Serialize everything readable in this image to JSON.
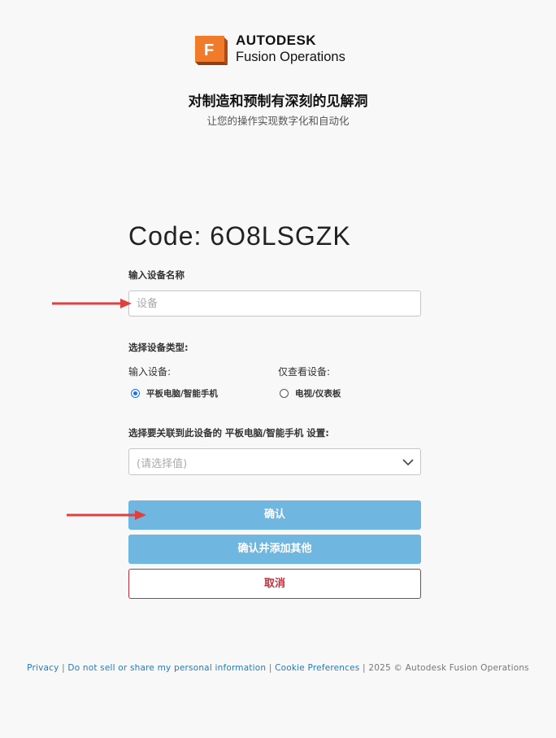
{
  "brand": {
    "name": "AUTODESK",
    "product": "Fusion Operations",
    "mark_letter": "F",
    "mark_color": "#f07b2a"
  },
  "headline": "对制造和预制有深刻的见解洞",
  "subheadline": "让您的操作实现数字化和自动化",
  "code_label": "Code: 6O8LSGZK",
  "device_name": {
    "label": "输入设备名称",
    "placeholder": "设备",
    "value": ""
  },
  "device_type": {
    "label": "选择设备类型:",
    "input_column_label": "输入设备:",
    "view_column_label": "仅查看设备:",
    "options": [
      {
        "label": "平板电脑/智能手机",
        "checked": true
      },
      {
        "label": "电视/仪表板",
        "checked": false
      }
    ]
  },
  "link_select": {
    "label": "选择要关联到此设备的 平板电脑/智能手机 设置:",
    "placeholder": "(请选择值)",
    "icon": "chevron-down-icon"
  },
  "buttons": {
    "confirm": "确认",
    "confirm_add": "确认并添加其他",
    "cancel": "取消"
  },
  "colors": {
    "primary_button": "#6fb6e0",
    "cancel_button": "#c0303a",
    "annotation_arrow": "#e04040",
    "link": "#2a79b3"
  },
  "footer": {
    "privacy": "Privacy",
    "do_not_sell": "Do not sell or share my personal information",
    "cookie": "Cookie Preferences",
    "separator": "|",
    "copyright": "2025 © Autodesk Fusion Operations"
  }
}
